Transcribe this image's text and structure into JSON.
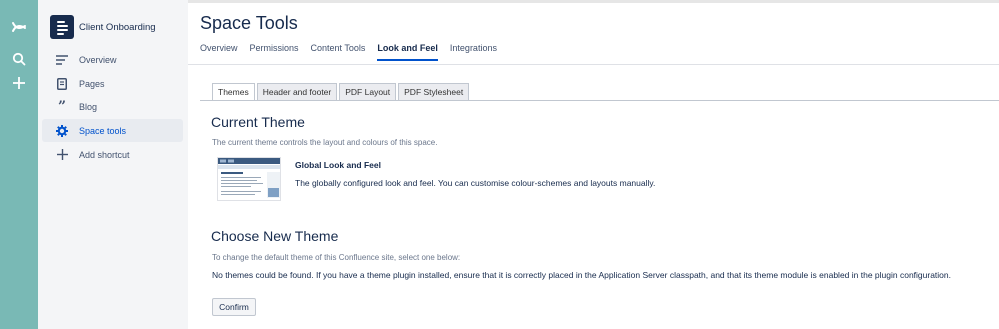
{
  "colors": {
    "rail": "#79b9b5",
    "sidebar": "#f4f5f7",
    "accent": "#0052cc",
    "text": "#172b4d"
  },
  "rail": {
    "icons": [
      "confluence-logo-icon",
      "search-icon",
      "create-plus-icon"
    ]
  },
  "sidebar": {
    "space_name": "Client Onboarding",
    "items": [
      {
        "label": "Overview",
        "icon": "overview-icon"
      },
      {
        "label": "Pages",
        "icon": "pages-icon"
      },
      {
        "label": "Blog",
        "icon": "blog-quote-icon"
      },
      {
        "label": "Space tools",
        "icon": "gear-icon",
        "active": true
      },
      {
        "label": "Add shortcut",
        "icon": "plus-icon"
      }
    ]
  },
  "main": {
    "title": "Space Tools",
    "tabs": [
      {
        "label": "Overview"
      },
      {
        "label": "Permissions"
      },
      {
        "label": "Content Tools"
      },
      {
        "label": "Look and Feel",
        "active": true
      },
      {
        "label": "Integrations"
      }
    ],
    "subtabs": [
      {
        "label": "Themes",
        "active": true
      },
      {
        "label": "Header and footer"
      },
      {
        "label": "PDF Layout"
      },
      {
        "label": "PDF Stylesheet"
      }
    ],
    "current_theme": {
      "heading": "Current Theme",
      "description": "The current theme controls the layout and colours of this space.",
      "theme_name": "Global Look and Feel",
      "theme_description": "The globally configured look and feel. You can customise colour-schemes and layouts manually."
    },
    "choose_theme": {
      "heading": "Choose New Theme",
      "description": "To change the default theme of this Confluence site, select one below:",
      "message": "No themes could be found. If you have a theme plugin installed, ensure that it is correctly placed in the Application Server classpath, and that its theme module is enabled in the plugin configuration.",
      "confirm_label": "Confirm"
    }
  }
}
